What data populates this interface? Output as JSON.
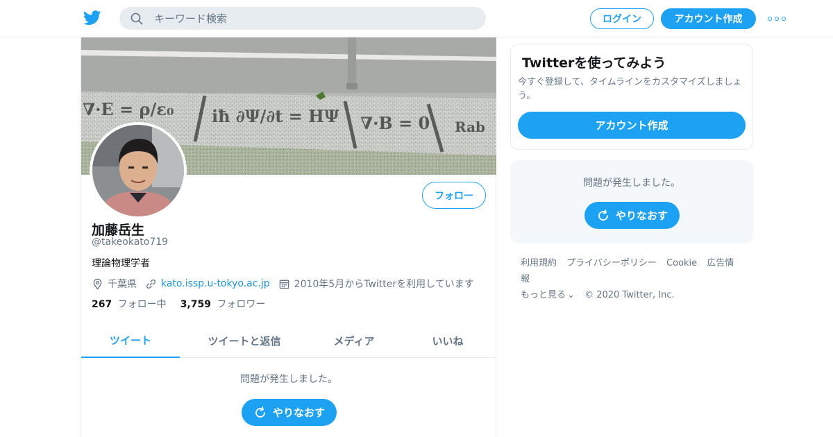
{
  "topbar": {
    "logo_icon": "twitter-bird-icon",
    "search_placeholder": "キーワード検索",
    "login_label": "ログイン",
    "signup_label": "アカウント作成",
    "more_icon": "more-dots-icon"
  },
  "profile": {
    "banner_formulas": [
      "∇·E = ρ/ε₀",
      "iħ ∂Ψ/∂t = HΨ",
      "∇·B = 0",
      "Rab"
    ],
    "display_name": "加藤岳生",
    "handle": "@takeokato719",
    "bio": "理論物理学者",
    "location": "千葉県",
    "website": "kato.issp.u-tokyo.ac.jp",
    "joined": "2010年5月からTwitterを利用しています",
    "following_count": "267",
    "following_label": "フォロー中",
    "followers_count": "3,759",
    "followers_label": "フォロワー",
    "follow_button": "フォロー"
  },
  "tabs": [
    {
      "label": "ツイート",
      "active": true
    },
    {
      "label": "ツイートと返信",
      "active": false
    },
    {
      "label": "メディア",
      "active": false
    },
    {
      "label": "いいね",
      "active": false
    }
  ],
  "timeline": {
    "error_message": "問題が発生しました。",
    "retry_label": "やりなおす"
  },
  "sidebar": {
    "signup_card": {
      "title": "Twitterを使ってみよう",
      "description": "今すぐ登録して、タイムラインをカスタマイズしましょう。",
      "button": "アカウント作成"
    },
    "error_box": {
      "message": "問題が発生しました。",
      "retry_label": "やりなおす"
    }
  },
  "footer": {
    "links": [
      "利用規約",
      "プライバシーポリシー",
      "Cookie",
      "広告情報"
    ],
    "more": "もっと見る",
    "copyright": "© 2020 Twitter, Inc."
  },
  "colors": {
    "accent": "#1da1f2",
    "link": "#1b95e0",
    "muted": "#657786",
    "text": "#14171a",
    "border": "#e6ecf0"
  }
}
